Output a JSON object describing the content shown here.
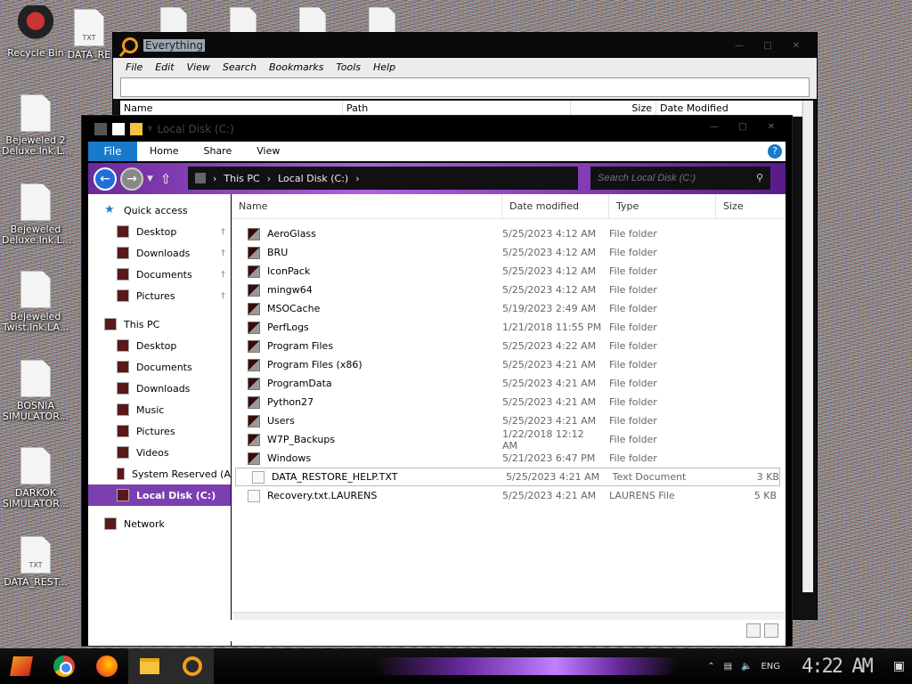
{
  "desktop": {
    "icons": [
      {
        "label": "Recycle Bin"
      },
      {
        "label": "DATA_RE"
      },
      {
        "label": "Bejeweled 2 Deluxe.lnk.L..."
      },
      {
        "label": "Bejeweled Deluxe.lnk.L..."
      },
      {
        "label": "Bejeweled Twist.lnk.LA..."
      },
      {
        "label": "BOSNIA SIMULATOR..."
      },
      {
        "label": "DARKOK SIMULATOR..."
      },
      {
        "label": "DATA_REST..."
      }
    ],
    "txt_badge": "TXT"
  },
  "everything": {
    "title": "Everything",
    "menu": [
      "File",
      "Edit",
      "View",
      "Search",
      "Bookmarks",
      "Tools",
      "Help"
    ],
    "search_value": "",
    "columns": [
      "Name",
      "Path",
      "Size",
      "Date Modified"
    ]
  },
  "explorer": {
    "title": "Local Disk (C:)",
    "ribbon": {
      "file": "File",
      "tabs": [
        "Home",
        "Share",
        "View"
      ],
      "help": "?"
    },
    "address": {
      "crumbs": [
        "This PC",
        "Local Disk (C:)"
      ]
    },
    "search_placeholder": "Search Local Disk (C:)",
    "sidebar": [
      {
        "label": "Quick access",
        "level": 0,
        "pin": false
      },
      {
        "label": "Desktop",
        "level": 1,
        "pin": true
      },
      {
        "label": "Downloads",
        "level": 1,
        "pin": true
      },
      {
        "label": "Documents",
        "level": 1,
        "pin": true
      },
      {
        "label": "Pictures",
        "level": 1,
        "pin": true
      },
      {
        "label": "This PC",
        "level": 0,
        "pin": false
      },
      {
        "label": "Desktop",
        "level": 1,
        "pin": false
      },
      {
        "label": "Documents",
        "level": 1,
        "pin": false
      },
      {
        "label": "Downloads",
        "level": 1,
        "pin": false
      },
      {
        "label": "Music",
        "level": 1,
        "pin": false
      },
      {
        "label": "Pictures",
        "level": 1,
        "pin": false
      },
      {
        "label": "Videos",
        "level": 1,
        "pin": false
      },
      {
        "label": "System Reserved (A",
        "level": 1,
        "pin": false
      },
      {
        "label": "Local Disk (C:)",
        "level": 1,
        "pin": false,
        "selected": true
      },
      {
        "label": "Network",
        "level": 0,
        "pin": false
      }
    ],
    "columns": [
      "Name",
      "Date modified",
      "Type",
      "Size"
    ],
    "files": [
      {
        "name": "AeroGlass",
        "date": "5/25/2023 4:12 AM",
        "type": "File folder",
        "size": ""
      },
      {
        "name": "BRU",
        "date": "5/25/2023 4:12 AM",
        "type": "File folder",
        "size": ""
      },
      {
        "name": "IconPack",
        "date": "5/25/2023 4:12 AM",
        "type": "File folder",
        "size": ""
      },
      {
        "name": "mingw64",
        "date": "5/25/2023 4:12 AM",
        "type": "File folder",
        "size": ""
      },
      {
        "name": "MSOCache",
        "date": "5/19/2023 2:49 AM",
        "type": "File folder",
        "size": ""
      },
      {
        "name": "PerfLogs",
        "date": "1/21/2018 11:55 PM",
        "type": "File folder",
        "size": ""
      },
      {
        "name": "Program Files",
        "date": "5/25/2023 4:22 AM",
        "type": "File folder",
        "size": ""
      },
      {
        "name": "Program Files (x86)",
        "date": "5/25/2023 4:21 AM",
        "type": "File folder",
        "size": ""
      },
      {
        "name": "ProgramData",
        "date": "5/25/2023 4:21 AM",
        "type": "File folder",
        "size": ""
      },
      {
        "name": "Python27",
        "date": "5/25/2023 4:21 AM",
        "type": "File folder",
        "size": ""
      },
      {
        "name": "Users",
        "date": "5/25/2023 4:21 AM",
        "type": "File folder",
        "size": ""
      },
      {
        "name": "W7P_Backups",
        "date": "1/22/2018 12:12 AM",
        "type": "File folder",
        "size": ""
      },
      {
        "name": "Windows",
        "date": "5/21/2023 6:47 PM",
        "type": "File folder",
        "size": ""
      },
      {
        "name": "DATA_RESTORE_HELP.TXT",
        "date": "5/25/2023 4:21 AM",
        "type": "Text Document",
        "size": "3 KB",
        "highlight": true
      },
      {
        "name": "Recovery.txt.LAURENS",
        "date": "5/25/2023 4:21 AM",
        "type": "LAURENS File",
        "size": "5 KB"
      }
    ]
  },
  "taskbar": {
    "lang": "ENG",
    "time": "4:22 AM"
  },
  "colors": {
    "accent": "#7c3fb0",
    "file_tab": "#1979ca",
    "everything_orange": "#f39a1c"
  }
}
